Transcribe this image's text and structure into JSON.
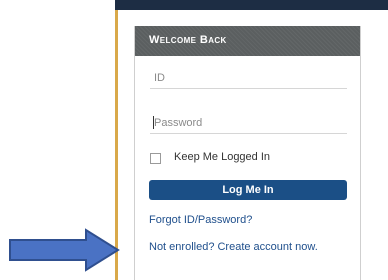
{
  "login": {
    "title": "Welcome Back",
    "id_placeholder": "ID",
    "password_placeholder": "Password",
    "remember_label": "Keep Me Logged In",
    "remember_checked": false,
    "button_label": "Log Me In",
    "forgot_link": "Forgot ID/Password?",
    "enroll_link": "Not enrolled? Create account now."
  },
  "colors": {
    "header_bar": "#1d2d44",
    "card_header": "#5b5f60",
    "button": "#1b4f86",
    "link": "#1f4f8c",
    "arrow_fill": "#4a72c4",
    "arrow_stroke": "#2f4f8f"
  },
  "annotation": {
    "arrow_icon": "right-arrow-icon"
  }
}
